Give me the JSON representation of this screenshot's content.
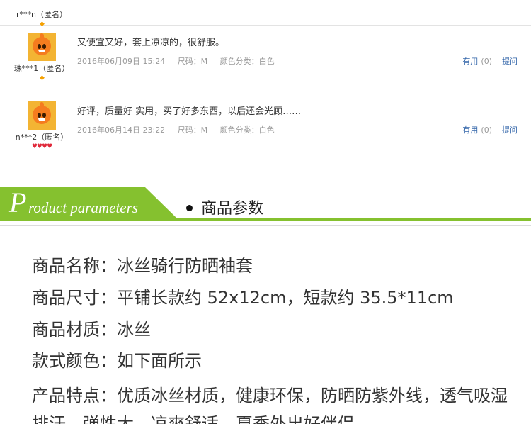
{
  "reviews": [
    {
      "username": "r***n（匿名）",
      "rank": "diamond"
    },
    {
      "username": "珠***1（匿名）",
      "content": "又便宜又好，套上凉凉的，很舒服。",
      "date": "2016年06月09日 15:24",
      "size": "尺码：M",
      "color": "颜色分类：白色",
      "useful_label": "有用",
      "useful_count": "(0)",
      "ask_label": "提问",
      "rank": "diamond"
    },
    {
      "username": "n***2（匿名）",
      "content": "好评，质量好 实用，买了好多东西，以后还会光顾……",
      "date": "2016年06月14日 23:22",
      "size": "尺码：M",
      "color": "颜色分类：白色",
      "useful_label": "有用",
      "useful_count": "(0)",
      "ask_label": "提问",
      "rank": "hearts"
    }
  ],
  "section": {
    "banner_initial": "P",
    "banner_rest": "roduct parameters",
    "title": "商品参数",
    "accent_color": "#85c12f"
  },
  "params": [
    {
      "label": "商品名称：",
      "value": "冰丝骑行防晒袖套"
    },
    {
      "label": "商品尺寸：",
      "value": "平铺长款约 52x12cm，短款约 35.5*11cm"
    },
    {
      "label": "商品材质：",
      "value": "冰丝"
    },
    {
      "label": "款式颜色：",
      "value": "如下面所示"
    },
    {
      "label": "产品特点：",
      "value": "优质冰丝材质，健康环保，防晒防紫外线，透气吸湿排汗，弹性大，凉爽舒适，夏季外出好伴侣"
    }
  ],
  "icons": {
    "avatar": "orange-cartoon-avatar-icon",
    "rank_diamond": "diamond-icon",
    "rank_heart": "heart-icon",
    "bullet": "bullet-dot-icon"
  }
}
